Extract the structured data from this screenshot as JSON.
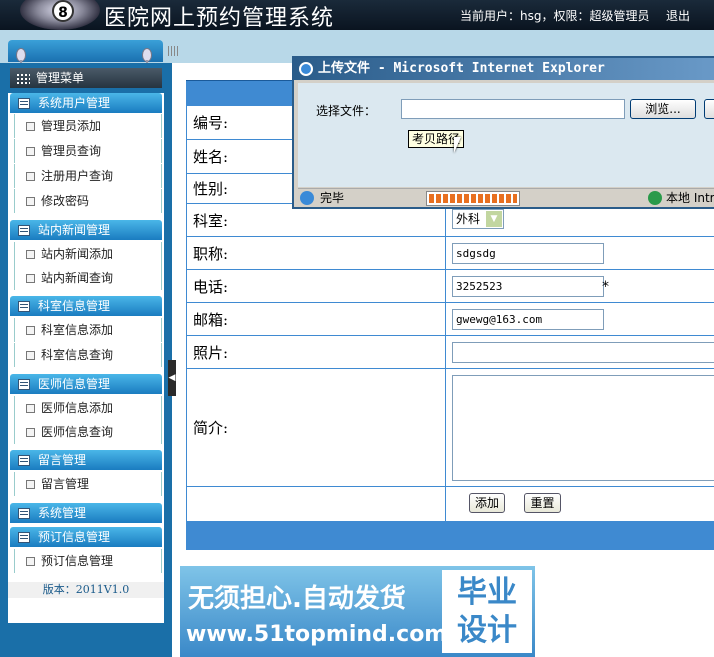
{
  "header": {
    "logo_badge": "8",
    "title": "医院网上预约管理系统",
    "user_info": "当前用户：hsg，权限：超级管理员",
    "logout": "退出"
  },
  "sidebar": {
    "menu_title": "管理菜单",
    "sections": [
      {
        "title": "系统用户管理",
        "items": [
          "管理员添加",
          "管理员查询",
          "注册用户查询",
          "修改密码"
        ]
      },
      {
        "title": "站内新闻管理",
        "items": [
          "站内新闻添加",
          "站内新闻查询"
        ]
      },
      {
        "title": "科室信息管理",
        "items": [
          "科室信息添加",
          "科室信息查询"
        ]
      },
      {
        "title": "医师信息管理",
        "items": [
          "医师信息添加",
          "医师信息查询"
        ]
      },
      {
        "title": "留言管理",
        "items": [
          "留言管理"
        ]
      },
      {
        "title": "系统管理",
        "items": []
      },
      {
        "title": "预订信息管理",
        "items": [
          "预订信息管理"
        ]
      }
    ],
    "version": "版本：2011V1.0"
  },
  "form": {
    "labels": {
      "number": "编号:",
      "name": "姓名:",
      "gender": "性别:",
      "department": "科室:",
      "title": "职称:",
      "phone": "电话:",
      "email": "邮箱:",
      "photo": "照片:",
      "intro": "简介:"
    },
    "department_value": "外科",
    "title_value": "sdgsdg",
    "phone_value": "3252523",
    "phone_required": "*",
    "email_value": "gwewg@163.com",
    "add_button": "添加",
    "reset_button": "重置"
  },
  "popup": {
    "title": "上传文件 - Microsoft Internet Explorer",
    "file_label": "选择文件：",
    "browse_button": "浏览...",
    "tooltip": "考贝路径",
    "status": "完毕",
    "progress": 1.0,
    "zone": "本地 Intr"
  },
  "watermark": {
    "line1": "无须担心.自动发货",
    "line2": "www.51topmind.com",
    "box_line1": "毕业",
    "box_line2": "设计"
  },
  "colors": {
    "header_bg": "#0a1420",
    "sidebar_bg": "#1a6fa8",
    "section_head": "#1a7cc0",
    "table_border": "#3f8ad2",
    "popup_title": "#2a5c8a"
  }
}
